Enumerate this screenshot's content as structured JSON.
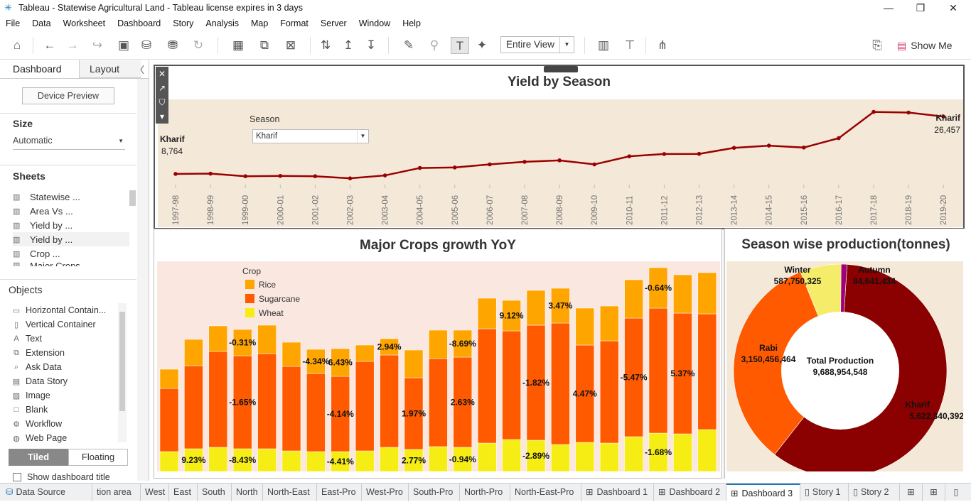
{
  "titlebar": {
    "title": "Tableau - Statewise Agricultural Land - Tableau license expires in 3 days"
  },
  "menu": [
    "File",
    "Data",
    "Worksheet",
    "Dashboard",
    "Story",
    "Analysis",
    "Map",
    "Format",
    "Server",
    "Window",
    "Help"
  ],
  "toolbar": {
    "fit": "Entire View",
    "show_me": "Show Me"
  },
  "leftpanel": {
    "tab_dashboard": "Dashboard",
    "tab_layout": "Layout",
    "device_preview": "Device Preview",
    "size_label": "Size",
    "size_value": "Automatic",
    "sheets_label": "Sheets",
    "sheets": [
      "Statewise ...",
      "Area Vs ...",
      "Yield by ...",
      "Yield by ...",
      "Crop ...",
      "Major Crops"
    ],
    "objects_label": "Objects",
    "objects": [
      "Horizontal Contain...",
      "Vertical Container",
      "Text",
      "Extension",
      "Ask Data",
      "Data Story",
      "Image",
      "Blank",
      "Workflow",
      "Web Page"
    ],
    "tiled": "Tiled",
    "floating": "Floating",
    "show_title": "Show dashboard title"
  },
  "yield_chart": {
    "title": "Yield by Season",
    "filter_label": "Season",
    "filter_value": "Kharif",
    "start_label": "Kharif",
    "start_value": "8,764",
    "end_label": "Kharif",
    "end_value": "26,457"
  },
  "crops_chart": {
    "title": "Major Crops growth YoY",
    "legend_title": "Crop",
    "legend": [
      "Rice",
      "Sugarcane",
      "Wheat"
    ]
  },
  "season_chart": {
    "title": "Season wise production(tonnes)",
    "center_label": "Total Production",
    "center_value": "9,688,954,548"
  },
  "colors": {
    "rice": "#ffa500",
    "sugarcane": "#ff5a00",
    "wheat": "#f5ed13",
    "kharif": "#8b0000",
    "rabi": "#ff5a00",
    "winter": "#f5ed6a",
    "autumn": "#a0007a",
    "line": "#990000",
    "plot_bg": "#f4e8d8",
    "crop_bg": "#fae8e0"
  },
  "chart_data": [
    {
      "type": "line",
      "title": "Yield by Season",
      "x": [
        "1997-98",
        "1998-99",
        "1999-00",
        "2000-01",
        "2001-02",
        "2002-03",
        "2003-04",
        "2004-05",
        "2005-06",
        "2006-07",
        "2007-08",
        "2008-09",
        "2009-10",
        "2010-11",
        "2011-12",
        "2012-13",
        "2013-14",
        "2014-15",
        "2015-16",
        "2016-17",
        "2017-18",
        "2018-19",
        "2019-20"
      ],
      "series": [
        {
          "name": "Kharif",
          "values": [
            8764,
            8850,
            8050,
            8150,
            8050,
            7400,
            8300,
            10600,
            10750,
            11700,
            12500,
            12950,
            11700,
            14200,
            14900,
            14950,
            16800,
            17500,
            16900,
            19800,
            27900,
            27700,
            26457
          ]
        }
      ],
      "grid": false
    },
    {
      "type": "bar",
      "title": "Major Crops growth YoY",
      "stacked": true,
      "categories": [
        "1",
        "2",
        "3",
        "4",
        "5",
        "6",
        "7",
        "8",
        "9",
        "10",
        "11",
        "12",
        "13",
        "14",
        "15",
        "16",
        "17",
        "18",
        "19",
        "20",
        "21",
        "22",
        "23"
      ],
      "series": [
        {
          "name": "Wheat",
          "values": [
            28,
            32,
            34,
            32,
            32,
            29,
            28,
            28,
            29,
            34,
            31,
            35,
            34,
            40,
            45,
            44,
            38,
            41,
            40,
            49,
            54,
            53,
            59
          ]
        },
        {
          "name": "Sugarcane",
          "values": [
            89,
            117,
            135,
            131,
            134,
            119,
            110,
            106,
            126,
            130,
            101,
            124,
            127,
            161,
            153,
            162,
            171,
            137,
            144,
            167,
            176,
            170,
            163
          ]
        },
        {
          "name": "Rice",
          "values": [
            27,
            37,
            36,
            37,
            40,
            34,
            34,
            39,
            23,
            23,
            39,
            40,
            38,
            43,
            43,
            49,
            49,
            52,
            49,
            54,
            57,
            54,
            58
          ]
        }
      ],
      "labels": [
        {
          "index": 1,
          "series": "Wheat",
          "text": "9.23%"
        },
        {
          "index": 3,
          "series": "Rice",
          "text": "-0.31%"
        },
        {
          "index": 3,
          "series": "Sugarcane",
          "text": "-1.65%"
        },
        {
          "index": 3,
          "series": "Wheat",
          "text": "-8.43%"
        },
        {
          "index": 6,
          "series": "Rice",
          "text": "-4.34%"
        },
        {
          "index": 7,
          "series": "Rice",
          "text": "6.43%"
        },
        {
          "index": 7,
          "series": "Sugarcane",
          "text": "-4.14%"
        },
        {
          "index": 7,
          "series": "Wheat",
          "text": "-4.41%"
        },
        {
          "index": 9,
          "series": "Rice",
          "text": "2.94%"
        },
        {
          "index": 10,
          "series": "Sugarcane",
          "text": "1.97%"
        },
        {
          "index": 10,
          "series": "Wheat",
          "text": "2.77%"
        },
        {
          "index": 12,
          "series": "Rice",
          "text": "-8.69%"
        },
        {
          "index": 12,
          "series": "Sugarcane",
          "text": "2.63%"
        },
        {
          "index": 12,
          "series": "Wheat",
          "text": "-0.94%"
        },
        {
          "index": 14,
          "series": "Rice",
          "text": "9.12%"
        },
        {
          "index": 15,
          "series": "Sugarcane",
          "text": "-1.82%"
        },
        {
          "index": 15,
          "series": "Wheat",
          "text": "-2.89%"
        },
        {
          "index": 16,
          "series": "Rice",
          "text": "3.47%"
        },
        {
          "index": 17,
          "series": "Sugarcane",
          "text": "4.47%"
        },
        {
          "index": 19,
          "series": "Sugarcane",
          "text": "-5.47%"
        },
        {
          "index": 20,
          "series": "Rice",
          "text": "-0.64%"
        },
        {
          "index": 20,
          "series": "Wheat",
          "text": "-1.68%"
        },
        {
          "index": 21,
          "series": "Sugarcane",
          "text": "5.37%"
        }
      ]
    },
    {
      "type": "pie",
      "title": "Season wise production(tonnes)",
      "donut": true,
      "slices": [
        {
          "name": "Kharif",
          "value": 5622340392,
          "label": "5,622,340,392"
        },
        {
          "name": "Rabi",
          "value": 3150456464,
          "label": "3,150,456,464"
        },
        {
          "name": "Winter",
          "value": 587750325,
          "label": "587,750,325"
        },
        {
          "name": "Autumn",
          "value": 84641434,
          "label": "84,641,434"
        }
      ]
    }
  ],
  "bottom_tabs": [
    "Data Source",
    "tion area",
    "West",
    "East",
    "South",
    "North",
    "North-East",
    "East-Pro",
    "West-Pro",
    "South-Pro",
    "North-Pro",
    "North-East-Pro",
    "Dashboard 1",
    "Dashboard 2",
    "Dashboard 3",
    "Story 1",
    "Story 2"
  ]
}
